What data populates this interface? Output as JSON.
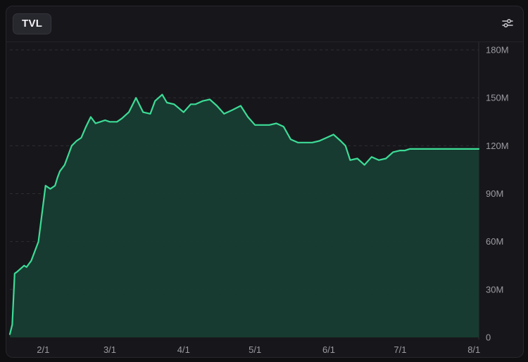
{
  "header": {
    "tab_label": "TVL",
    "settings_icon": "sliders-icon"
  },
  "colors": {
    "line": "#3ddc97",
    "area": "#173d31",
    "grid": "#2c2c33",
    "tick_text": "#9a9aa2"
  },
  "chart_data": {
    "type": "area",
    "title": "",
    "xlabel": "",
    "ylabel": "",
    "x_ticks": [
      "2/1",
      "3/1",
      "4/1",
      "5/1",
      "6/1",
      "7/1",
      "8/1"
    ],
    "y_ticks": [
      "0",
      "30M",
      "60M",
      "90M",
      "120M",
      "150M",
      "180M"
    ],
    "ylim": [
      0,
      180
    ],
    "xlim": [
      "2023-01-18",
      "2023-08-03"
    ],
    "grid": "horizontal dashed",
    "series": [
      {
        "name": "",
        "x": [
          "2023-01-18",
          "2023-01-19",
          "2023-01-20",
          "2023-01-21",
          "2023-01-24",
          "2023-01-25",
          "2023-01-27",
          "2023-01-30",
          "2023-02-02",
          "2023-02-04",
          "2023-02-06",
          "2023-02-07",
          "2023-02-08",
          "2023-02-10",
          "2023-02-13",
          "2023-02-15",
          "2023-02-17",
          "2023-02-19",
          "2023-02-21",
          "2023-02-23",
          "2023-02-25",
          "2023-02-27",
          "2023-03-01",
          "2023-03-04",
          "2023-03-06",
          "2023-03-09",
          "2023-03-12",
          "2023-03-15",
          "2023-03-18",
          "2023-03-20",
          "2023-03-23",
          "2023-03-25",
          "2023-03-28",
          "2023-04-01",
          "2023-04-04",
          "2023-04-06",
          "2023-04-09",
          "2023-04-12",
          "2023-04-15",
          "2023-04-18",
          "2023-04-21",
          "2023-04-25",
          "2023-04-28",
          "2023-05-01",
          "2023-05-04",
          "2023-05-07",
          "2023-05-10",
          "2023-05-13",
          "2023-05-16",
          "2023-05-19",
          "2023-05-22",
          "2023-05-25",
          "2023-05-28",
          "2023-05-31",
          "2023-06-03",
          "2023-06-06",
          "2023-06-08",
          "2023-06-10",
          "2023-06-13",
          "2023-06-16",
          "2023-06-19",
          "2023-06-22",
          "2023-06-25",
          "2023-06-28",
          "2023-07-01",
          "2023-07-03",
          "2023-07-05",
          "2023-07-08",
          "2023-07-11",
          "2023-07-14",
          "2023-07-17",
          "2023-07-20",
          "2023-07-23",
          "2023-07-26",
          "2023-07-29",
          "2023-08-01",
          "2023-08-03"
        ],
        "y": [
          2,
          8,
          40,
          41,
          45,
          44,
          48,
          60,
          95,
          93,
          95,
          100,
          104,
          108,
          120,
          123,
          125,
          132,
          138,
          134,
          135,
          136,
          135,
          135,
          137,
          141,
          150,
          141,
          140,
          148,
          152,
          147,
          146,
          141,
          146,
          146,
          148,
          149,
          145,
          140,
          142,
          145,
          138,
          133,
          133,
          133,
          134,
          132,
          124,
          122,
          122,
          122,
          123,
          125,
          127,
          123,
          120,
          111,
          112,
          108,
          113,
          111,
          112,
          116,
          117,
          117,
          118,
          118,
          118,
          118,
          118,
          118,
          118,
          118,
          118,
          118,
          118
        ]
      }
    ]
  }
}
